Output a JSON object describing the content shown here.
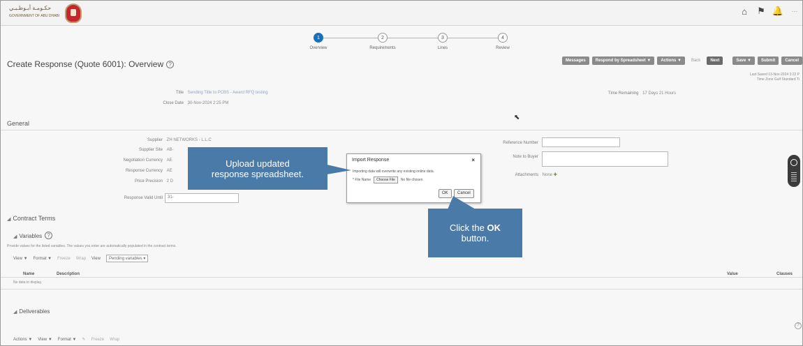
{
  "brand": {
    "arabic": "حكـومـة أبـوظـبـي",
    "english": "GOVERNMENT OF ABU DHABI"
  },
  "top_icons": [
    "home-icon",
    "flag-icon",
    "bell-icon",
    "more-icon"
  ],
  "train": {
    "steps": [
      {
        "num": "1",
        "label": "Overview"
      },
      {
        "num": "2",
        "label": "Requirements"
      },
      {
        "num": "3",
        "label": "Lines"
      },
      {
        "num": "4",
        "label": "Review"
      }
    ],
    "active_index": 0
  },
  "page": {
    "title": "Create Response (Quote 6001): Overview"
  },
  "toolbar": {
    "messages": "Messages",
    "respond_by_spreadsheet": "Respond by Spreadsheet",
    "actions": "Actions",
    "back": "Back",
    "next": "Next",
    "save": "Save",
    "submit": "Submit",
    "cancel": "Cancel",
    "dropdown_glyph": "▼"
  },
  "last_saved": {
    "line1": "Last Saved 13-Nov-2024 3:22 P",
    "line2": "Time Zone Gulf Standard Ti"
  },
  "header": {
    "title_label": "Title",
    "title_value": "Sending Title to PCBS - Award RFQ testing",
    "close_label": "Close Date",
    "close_value": "30-Nov-2024 2:25 PM",
    "time_label": "Time Remaining",
    "time_value": "17 Days 21 Hours"
  },
  "general": {
    "heading": "General",
    "supplier_label": "Supplier",
    "supplier_value": "ZH NETWORKS - L.L.C",
    "site_label": "Supplier Site",
    "site_value": "AB-",
    "neg_curr_label": "Negotiation Currency",
    "neg_curr_value": "AE",
    "resp_curr_label": "Response Currency",
    "resp_curr_value": "AE",
    "price_prec_label": "Price Precision",
    "price_prec_value": "2 D",
    "valid_label": "Response Valid Until",
    "valid_value": "31-",
    "ref_label": "Reference Number",
    "note_label": "Note to Buyer",
    "attach_label": "Attachments",
    "attach_value": "None"
  },
  "contract": {
    "heading": "Contract Terms",
    "variables_heading": "Variables",
    "note": "Provide values for the listed variables. The values you enter are automatically populated in the contract terms.",
    "bar": {
      "view": "View ▼",
      "format": "Format ▼",
      "freeze": "Freeze",
      "wrap": "Wrap",
      "view_label": "View",
      "view_select": "Pending variables ▾"
    },
    "cols": {
      "name": "Name",
      "desc": "Description",
      "value": "Value",
      "clauses": "Clauses"
    },
    "nodata": "No data to display."
  },
  "deliverables": {
    "heading": "Deliverables",
    "bar": {
      "actions": "Actions ▼",
      "view": "View ▼",
      "format": "Format ▼",
      "freeze": "Freeze",
      "wrap": "Wrap"
    }
  },
  "dialog": {
    "title": "Import Response",
    "close": "×",
    "message": "Importing data will overwrite any existing online data.",
    "file_label": "* File Name",
    "choose": "Choose File",
    "no_file": "No file chosen",
    "ok": "OK",
    "cancel": "Cancel"
  },
  "callouts": {
    "upload": [
      "Upload updated",
      "response spreadsheet."
    ],
    "click_prefix": "Click the ",
    "click_bold": "OK",
    "click_suffix": "button."
  },
  "colors": {
    "accent": "#1c6fb6",
    "callout": "#4a7aa8"
  }
}
